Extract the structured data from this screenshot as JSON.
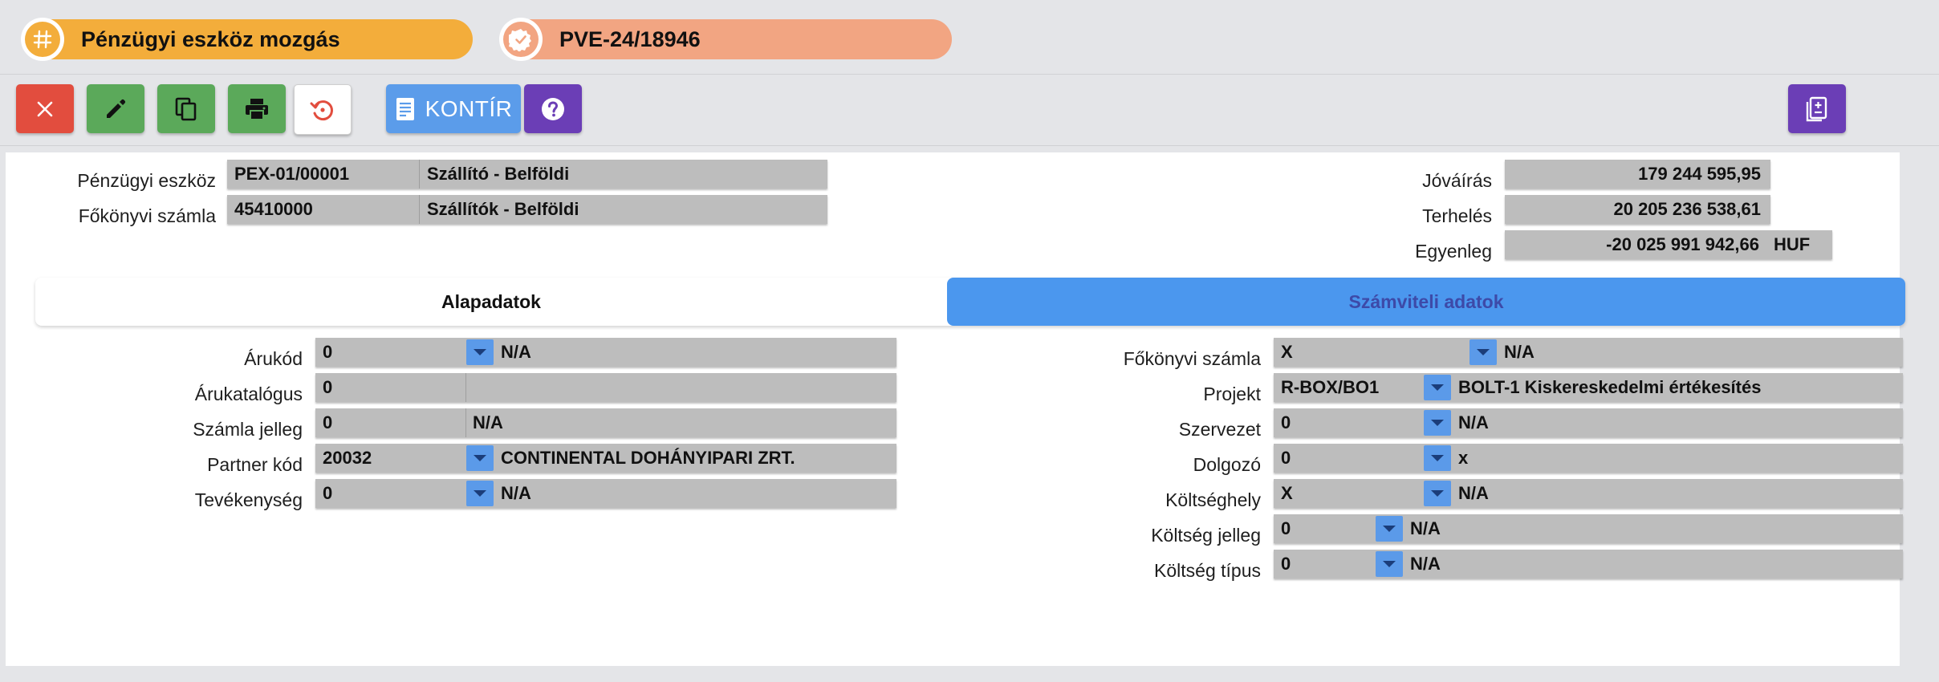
{
  "header": {
    "doc_type": "Pénzügyi eszköz mozgás",
    "doc_number": "PVE-24/18946"
  },
  "toolbar": {
    "kontir_label": "KONTÍR"
  },
  "summary": {
    "asset_label": "Pénzügyi eszköz",
    "asset_code": "PEX-01/00001",
    "asset_name": "Szállító - Belföldi",
    "ledger_label": "Főkönyvi számla",
    "ledger_code": "45410000",
    "ledger_name": "Szállítók - Belföldi",
    "credit_label": "Jóváírás",
    "credit_value": "179 244 595,95",
    "debit_label": "Terhelés",
    "debit_value": "20 205 236 538,61",
    "balance_label": "Egyenleg",
    "balance_value": "-20 025 991 942,66",
    "currency": "HUF"
  },
  "tabs": [
    {
      "label": "Alapadatok"
    },
    {
      "label": "Számviteli adatok"
    }
  ],
  "left_fields": {
    "item_code": {
      "label": "Árukód",
      "value": "0",
      "desc": "N/A"
    },
    "catalog": {
      "label": "Árukatalógus",
      "value": "0",
      "desc": ""
    },
    "invoice_type": {
      "label": "Számla jelleg",
      "value": "0",
      "desc": "N/A"
    },
    "partner": {
      "label": "Partner kód",
      "value": "20032",
      "desc": "CONTINENTAL DOHÁNYIPARI ZRT."
    },
    "activity": {
      "label": "Tevékenység",
      "value": "0",
      "desc": "N/A"
    }
  },
  "right_fields": {
    "ledger": {
      "label": "Főkönyvi számla",
      "value": "X",
      "desc": "N/A"
    },
    "project": {
      "label": "Projekt",
      "value": "R-BOX/BO1",
      "desc": "BOLT-1 Kiskereskedelmi értékesítés"
    },
    "organization": {
      "label": "Szervezet",
      "value": "0",
      "desc": "N/A"
    },
    "employee": {
      "label": "Dolgozó",
      "value": "0",
      "desc": "x"
    },
    "cost_center": {
      "label": "Költséghely",
      "value": "X",
      "desc": "N/A"
    },
    "cost_nature": {
      "label": "Költség jelleg",
      "value": "0",
      "desc": "N/A"
    },
    "cost_type": {
      "label": "Költség típus",
      "value": "0",
      "desc": "N/A"
    }
  },
  "colors": {
    "doc_pill": "#f3ad3b",
    "number_pill": "#f2a582",
    "close": "#e24d3e",
    "green": "#5ba95a",
    "kontir": "#5b9cea",
    "purple": "#6b3eb6",
    "active_tab": "#4b97ee"
  }
}
